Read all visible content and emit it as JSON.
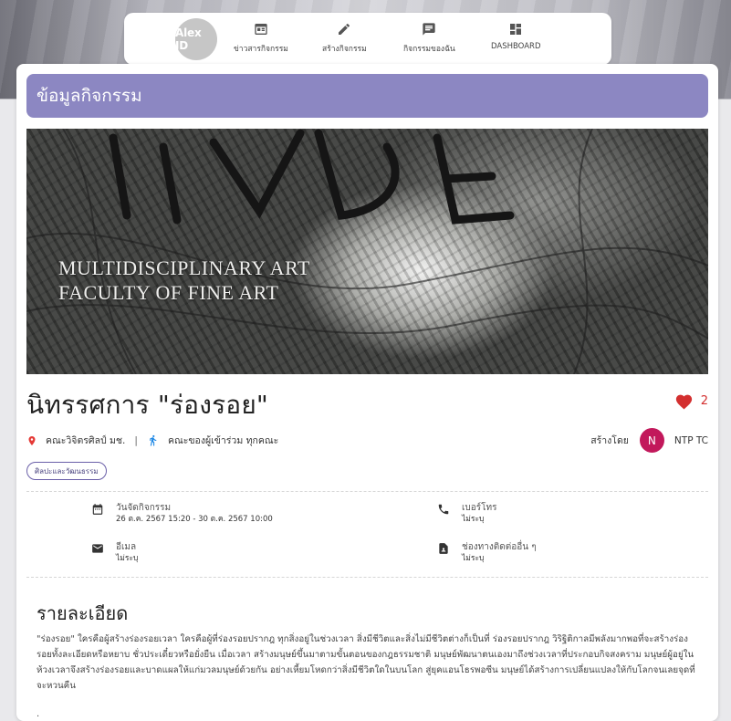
{
  "nav": {
    "avatar_text": "Alex JD",
    "items": [
      {
        "label": "ข่าวสารกิจกรรม",
        "icon": "news-icon"
      },
      {
        "label": "สร้างกิจกรรม",
        "icon": "pencil-icon"
      },
      {
        "label": "กิจกรรมของฉัน",
        "icon": "chat-icon"
      },
      {
        "label": "DASHBOARD",
        "icon": "dashboard-icon"
      }
    ]
  },
  "page": {
    "header": "ข้อมูลกิจกรรม",
    "hero_text": [
      "MULTIDISCIPLINARY ART",
      "FACULTY OF FINE ART"
    ],
    "title": "นิทรรศการ \"ร่องรอย\"",
    "likes": "2",
    "location": "คณะวิจิตรศิลป์ มช.",
    "participants": "คณะของผู้เข้าร่วม ทุกคณะ",
    "created_by_label": "สร้างโดย",
    "creator_initial": "N",
    "creator_name": "NTP TC",
    "category": "ศิลปะและวัฒนธรรม"
  },
  "info": {
    "date_label": "วันจัดกิจกรรม",
    "date_value": "26 ต.ค. 2567 15:20 - 30 ต.ค. 2567 10:00",
    "phone_label": "เบอร์โทร",
    "phone_value": "ไม่ระบุ",
    "email_label": "อีเมล",
    "email_value": "ไม่ระบุ",
    "other_label": "ช่องทางติดต่ออื่น ๆ",
    "other_value": "ไม่ระบุ"
  },
  "details": {
    "title": "รายละเอียด",
    "body": "\"ร่องรอย\" ใครคือผู้สร้างร่องรอยเวลา ใครคือผู้ที่ร่องรอยปรากฎ ทุกสิ่งอยู่ในช่วงเวลา สิ่งมีชีวิตและสิ่งไม่มีชีวิตต่างก็เป็นที่ ร่องรอยปรากฎ วิริฐิติกาลมีพลังมากพอที่จะสร้างร่องรอยทั้งละเอียดหรือหยาบ ชั่วประเดี๋ยวหรือยั่งยืน เมื่อเวลา สร้างมนุษย์ขึ้นมาตามขั้นตอนของกฎธรรมชาติ มนุษย์พัฒนาตนเองมาถึงช่วงเวลาที่ประกอบกิจสงคราม มนุษย์ผู้อยู่ในห้วงเวลาจึงสร้างร่องรอยและบาดแผลให้แก่มวลมนุษย์ด้วยกัน อย่างเหี้ยมโหดกว่าสิ่งมีชีวิตใดในบนโลก สู่ยุคแอนโธรพอซีน มนุษย์ได้สร้างการเปลี่ยนแปลงให้กับโลกจนเลยจุดที่จะหวนคืน",
    "trailing": "."
  },
  "colors": {
    "header": "#8c87c2",
    "heart": "#d32f2f",
    "creator_badge": "#c2185b",
    "location_pin": "#e53935",
    "person_icon": "#1e88e5"
  }
}
